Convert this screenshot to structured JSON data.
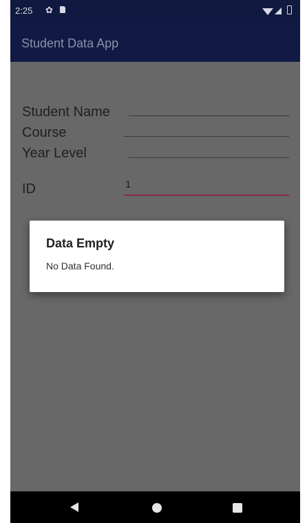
{
  "status_bar": {
    "time": "2:25",
    "icons": [
      "settings-icon",
      "sd-card-icon",
      "wifi-icon",
      "signal-icon",
      "battery-icon"
    ]
  },
  "app_bar": {
    "title": "Student Data App"
  },
  "form": {
    "student_name_label": "Student Name",
    "course_label": "Course",
    "year_level_label": "Year Level",
    "id_label": "ID",
    "id_value": "1"
  },
  "dialog": {
    "title": "Data Empty",
    "message": "No Data Found."
  },
  "nav_bar": {
    "icons": [
      "back-icon",
      "home-icon",
      "recents-icon"
    ]
  },
  "colors": {
    "app_bar": "#111a44",
    "scrim_background": "#686868",
    "id_underline": "#8c2b45",
    "dialog_background": "#ffffff"
  }
}
